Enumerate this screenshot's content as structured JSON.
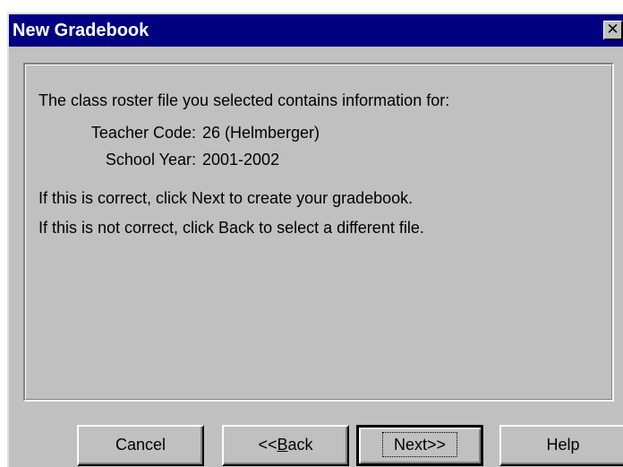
{
  "window": {
    "title": "New Gradebook",
    "close_glyph": "✕"
  },
  "message": {
    "intro": "The class roster file you selected contains information for:",
    "teacher_code_label": "Teacher Code:",
    "teacher_code_value": "26 (Helmberger)",
    "school_year_label": "School Year:",
    "school_year_value": "2001-2002",
    "next_hint": "If this is correct, click Next to create your gradebook.",
    "back_hint": "If this is not correct, click Back to select a different file."
  },
  "buttons": {
    "cancel": "Cancel",
    "back_prefix": "<<",
    "back_mnemonic": "B",
    "back_suffix": "ack",
    "next": "Next>>",
    "help": "Help"
  },
  "colors": {
    "titlebar": "#000080",
    "face": "#c0c0c0"
  },
  "icons": {
    "close": "close-icon"
  }
}
